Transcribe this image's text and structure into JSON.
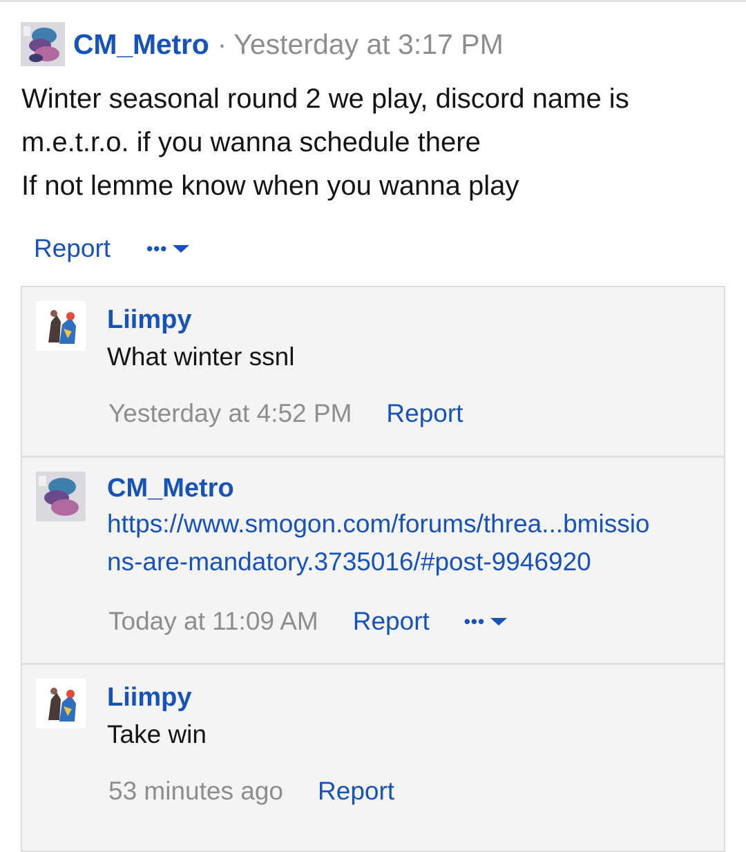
{
  "post": {
    "author": "CM_Metro",
    "separator": "·",
    "time": "Yesterday at 3:17 PM",
    "body_lines": [
      "Winter seasonal round 2 we play, discord name is",
      "m.e.t.r.o. if you wanna schedule there",
      "If not lemme know when you wanna play"
    ],
    "actions": {
      "report": "Report",
      "more": "•••"
    }
  },
  "comments": [
    {
      "author": "Liimpy",
      "text": "What winter ssnl",
      "time": "Yesterday at 4:52 PM",
      "report": "Report"
    },
    {
      "author": "CM_Metro",
      "link_lines": [
        "https://www.smogon.com/forums/threa...bmissio",
        "ns-are-mandatory.3735016/#post-9946920"
      ],
      "time": "Today at 11:09 AM",
      "report": "Report",
      "more": "•••"
    },
    {
      "author": "Liimpy",
      "text": "Take win",
      "time": "53 minutes ago",
      "report": "Report"
    }
  ],
  "colors": {
    "link": "#1652b8",
    "muted": "#8d8d8d",
    "comment_bg": "#f4f4f4"
  },
  "icons": {
    "post_avatar": "avatar-icon",
    "more": "chevron-down-icon"
  }
}
